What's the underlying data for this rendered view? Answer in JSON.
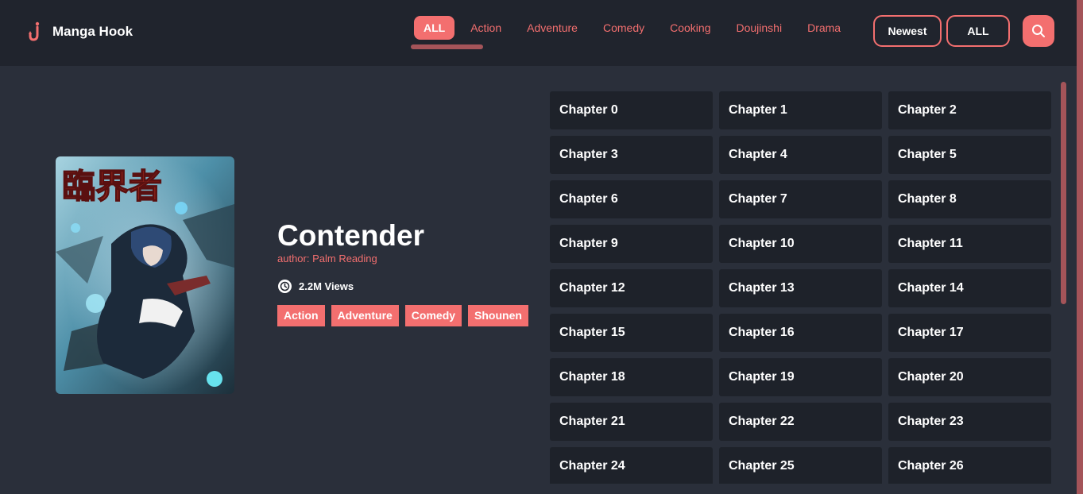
{
  "app": {
    "name": "Manga Hook"
  },
  "nav": {
    "genres": [
      "ALL",
      "Action",
      "Adventure",
      "Comedy",
      "Cooking",
      "Doujinshi",
      "Drama"
    ],
    "sort_label": "Newest",
    "filter_label": "ALL"
  },
  "manga": {
    "title": "Contender",
    "author": "author: Palm Reading",
    "views": "2.2M Views",
    "tags": [
      "Action",
      "Adventure",
      "Comedy",
      "Shounen"
    ]
  },
  "chapters": [
    "Chapter 0",
    "Chapter 1",
    "Chapter 2",
    "Chapter 3",
    "Chapter 4",
    "Chapter 5",
    "Chapter 6",
    "Chapter 7",
    "Chapter 8",
    "Chapter 9",
    "Chapter 10",
    "Chapter 11",
    "Chapter 12",
    "Chapter 13",
    "Chapter 14",
    "Chapter 15",
    "Chapter 16",
    "Chapter 17",
    "Chapter 18",
    "Chapter 19",
    "Chapter 20",
    "Chapter 21",
    "Chapter 22",
    "Chapter 23",
    "Chapter 24",
    "Chapter 25",
    "Chapter 26"
  ],
  "colors": {
    "accent": "#f36f6f",
    "header_bg": "#20242d",
    "page_bg": "#2a2f3a",
    "chapter_bg": "#1e222a",
    "scrollbar": "#a45459"
  },
  "icons": {
    "logo": "hook-icon",
    "search": "search-icon",
    "views": "views-icon"
  }
}
